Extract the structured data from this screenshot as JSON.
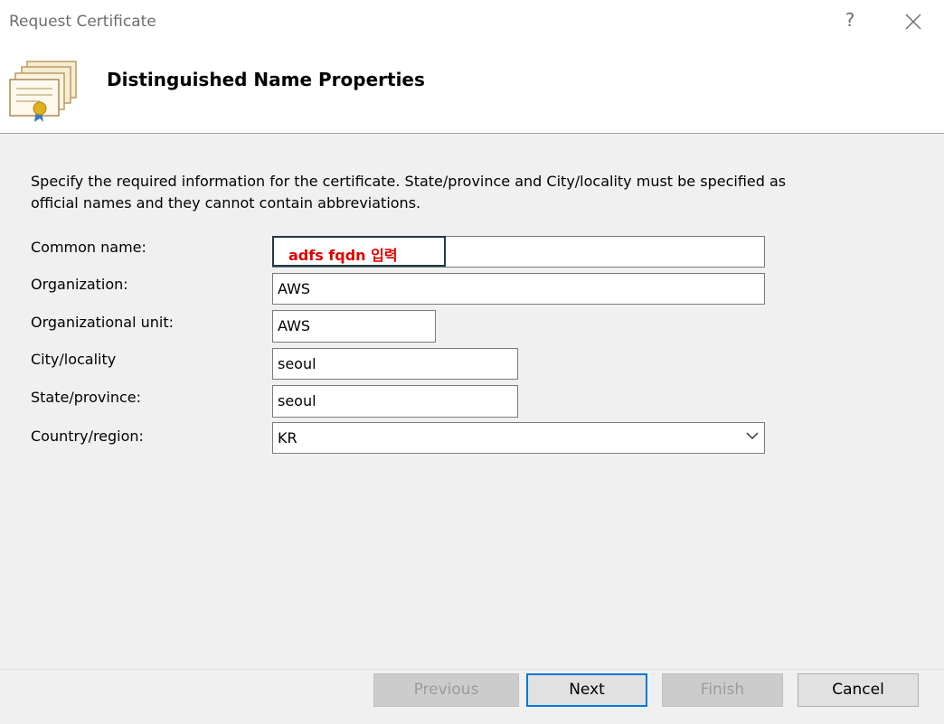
{
  "window": {
    "title": "Request Certificate",
    "help_glyph": "?",
    "close_icon": "close-icon"
  },
  "header": {
    "icon": "certificate-icon",
    "title": "Distinguished Name Properties"
  },
  "instructions": "Specify the required information for the certificate. State/province and City/locality must be specified as official names and they cannot contain abbreviations.",
  "form": {
    "common_name": {
      "label": "Common name:",
      "annotation": "adfs fqdn 입력",
      "annotation_color": "#e00000"
    },
    "organization": {
      "label": "Organization:",
      "value": "AWS"
    },
    "organizational_unit": {
      "label": "Organizational unit:",
      "value": "AWS"
    },
    "city": {
      "label": "City/locality",
      "value": "seoul"
    },
    "state": {
      "label": "State/province:",
      "value": "seoul"
    },
    "country": {
      "label": "Country/region:",
      "value": "KR"
    }
  },
  "buttons": {
    "previous": "Previous",
    "next": "Next",
    "finish": "Finish",
    "cancel": "Cancel"
  },
  "colors": {
    "accent": "#0078d7",
    "annotation": "#e00000",
    "dialog_bg": "#f0f0f0"
  }
}
